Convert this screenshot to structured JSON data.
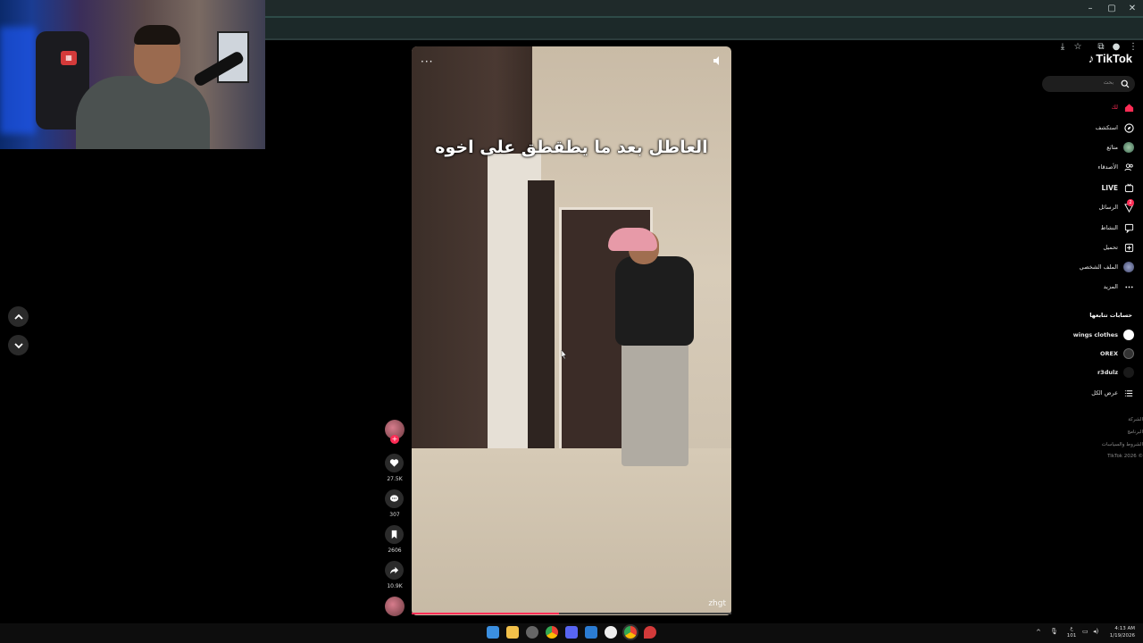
{
  "browser": {
    "window_controls": [
      "–",
      "▢",
      "✕"
    ],
    "toolbar_icons": [
      "install-icon",
      "star-icon",
      "extensions-icon",
      "profile-icon",
      "menu-icon"
    ]
  },
  "video": {
    "caption": "العاطل بعد ما يطقطق على اخوه",
    "watermark": "zhgt",
    "progress_fraction": 0.46
  },
  "actions": {
    "likes": "27.5K",
    "comments": "307",
    "saves": "2606",
    "shares": "10.9K"
  },
  "sidebar": {
    "logo": "TikTok",
    "search_placeholder": "بحث",
    "nav": [
      {
        "label": "لك",
        "icon": "home-icon",
        "active": true
      },
      {
        "label": "استكشف",
        "icon": "compass-icon"
      },
      {
        "label": "متابَع",
        "icon": "avatar-icon"
      },
      {
        "label": "الأصدقاء",
        "icon": "friends-icon"
      },
      {
        "label": "LIVE",
        "icon": "live-icon"
      },
      {
        "label": "الرسائل",
        "icon": "messages-icon",
        "badge": "2"
      },
      {
        "label": "النشاط",
        "icon": "activity-icon"
      },
      {
        "label": "تحميل",
        "icon": "upload-icon"
      },
      {
        "label": "الملف الشخصي",
        "icon": "profile-icon"
      },
      {
        "label": "المزيد",
        "icon": "more-icon"
      }
    ],
    "following_title": "حسابات تتابعها",
    "following": [
      {
        "name": "wings clothes"
      },
      {
        "name": "OREX"
      },
      {
        "name": "r3dulz"
      }
    ],
    "see_all": "عرض الكل",
    "footer": [
      "الشركة",
      "البرنامج",
      "الشروط والسياسات",
      "© 2026 TikTok"
    ]
  },
  "taskbar": {
    "lang": "ع",
    "lang_sub": "101",
    "time": "4:13 AM",
    "date": "1/19/2026"
  },
  "colors": {
    "accent": "#fe2c55",
    "chrome": "#1c2929",
    "background": "#000000"
  }
}
